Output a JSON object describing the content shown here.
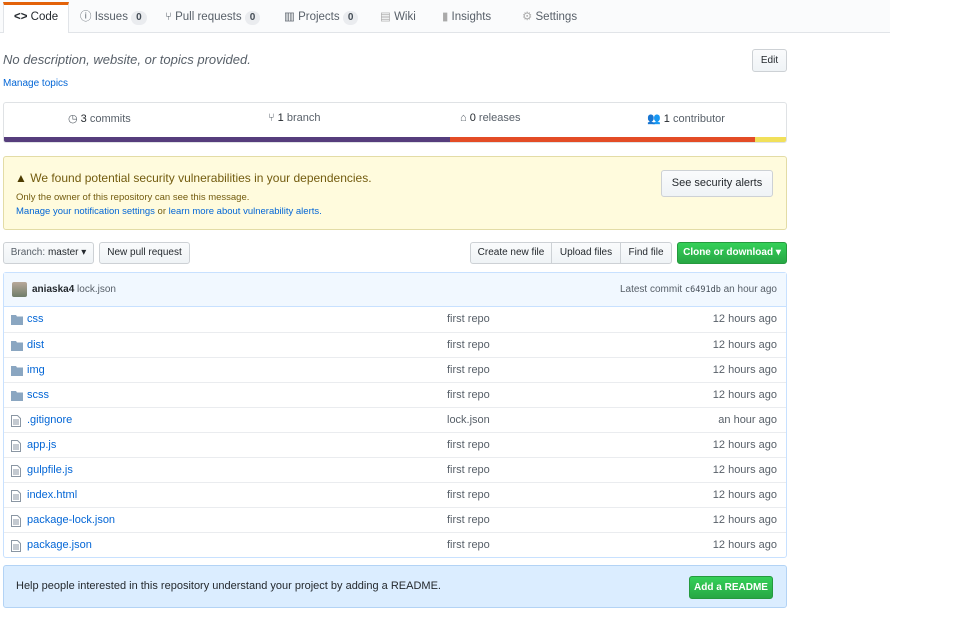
{
  "tabs": [
    {
      "label": "Code",
      "icon": "code-icon"
    },
    {
      "label": "Issues",
      "count": "0",
      "icon": "issue-icon"
    },
    {
      "label": "Pull requests",
      "count": "0",
      "icon": "pull-request-icon"
    },
    {
      "label": "Projects",
      "count": "0",
      "icon": "project-icon"
    },
    {
      "label": "Wiki",
      "icon": "book-icon"
    },
    {
      "label": "Insights",
      "icon": "graph-icon"
    },
    {
      "label": "Settings",
      "icon": "gear-icon"
    }
  ],
  "description": "No description, website, or topics provided.",
  "edit_label": "Edit",
  "manage_topics": "Manage topics",
  "summary": {
    "commits_num": "3",
    "commits_label": "commits",
    "branch_num": "1",
    "branch_label": "branch",
    "releases_num": "0",
    "releases_label": "releases",
    "contributors_num": "1",
    "contributors_label": "contributor"
  },
  "languages": [
    {
      "color": "#563d7c",
      "percent": 57
    },
    {
      "color": "#e34c26",
      "percent": 39
    },
    {
      "color": "#f1e05a",
      "percent": 4
    }
  ],
  "alert": {
    "title": "We found potential security vulnerabilities in your dependencies.",
    "note": "Only the owner of this repository can see this message.",
    "link1": "Manage your notification settings",
    "or": "or",
    "link2": "learn more about vulnerability alerts.",
    "button": "See security alerts"
  },
  "toolbar": {
    "branch_prefix": "Branch:",
    "branch": "master",
    "new_pr": "New pull request",
    "create_file": "Create new file",
    "upload": "Upload files",
    "find": "Find file",
    "clone": "Clone or download"
  },
  "commit": {
    "author": "aniaska4",
    "message": "lock.json",
    "latest_label": "Latest commit",
    "sha": "c6491db",
    "age": "an hour ago"
  },
  "files": [
    {
      "name": "css",
      "type": "folder",
      "message": "first repo",
      "age": "12 hours ago"
    },
    {
      "name": "dist",
      "type": "folder",
      "message": "first repo",
      "age": "12 hours ago"
    },
    {
      "name": "img",
      "type": "folder",
      "message": "first repo",
      "age": "12 hours ago"
    },
    {
      "name": "scss",
      "type": "folder",
      "message": "first repo",
      "age": "12 hours ago"
    },
    {
      "name": ".gitignore",
      "type": "file",
      "message": "lock.json",
      "age": "an hour ago"
    },
    {
      "name": "app.js",
      "type": "file",
      "message": "first repo",
      "age": "12 hours ago"
    },
    {
      "name": "gulpfile.js",
      "type": "file",
      "message": "first repo",
      "age": "12 hours ago"
    },
    {
      "name": "index.html",
      "type": "file",
      "message": "first repo",
      "age": "12 hours ago"
    },
    {
      "name": "package-lock.json",
      "type": "file",
      "message": "first repo",
      "age": "12 hours ago"
    },
    {
      "name": "package.json",
      "type": "file",
      "message": "first repo",
      "age": "12 hours ago"
    }
  ],
  "readme": {
    "text": "Help people interested in this repository understand your project by adding a README.",
    "button": "Add a README"
  }
}
